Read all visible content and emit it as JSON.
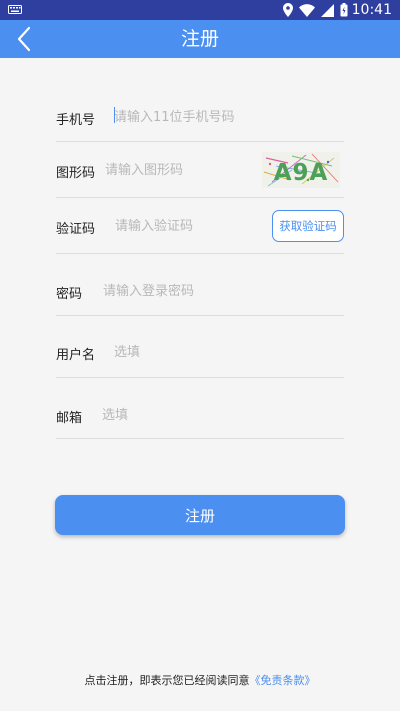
{
  "status_bar": {
    "time": "10:41",
    "icons": [
      "keyboard-icon",
      "location-icon",
      "wifi-icon",
      "signal-icon",
      "battery-icon"
    ]
  },
  "app_bar": {
    "title": "注册",
    "back_icon": "chevron-left-icon"
  },
  "form": {
    "phone": {
      "label": "手机号",
      "placeholder": "请输入11位手机号码",
      "value": ""
    },
    "captcha": {
      "label": "图形码",
      "placeholder": "请输入图形码",
      "value": "",
      "image_text": "A9A"
    },
    "sms_code": {
      "label": "验证码",
      "placeholder": "请输入验证码",
      "value": "",
      "button_label": "获取验证码"
    },
    "password": {
      "label": "密码",
      "placeholder": "请输入登录密码",
      "value": ""
    },
    "username": {
      "label": "用户名",
      "placeholder": "选填",
      "value": ""
    },
    "email": {
      "label": "邮箱",
      "placeholder": "选填",
      "value": ""
    }
  },
  "register_button": {
    "label": "注册"
  },
  "agreement": {
    "prefix": "点击注册，即表示您已经阅读同意",
    "link": "《免责条款》"
  },
  "colors": {
    "status_bar": "#2f3f9f",
    "primary": "#4b8ff0",
    "background": "#f5f5f5",
    "divider": "#dddddd",
    "placeholder": "#b8b8b8"
  }
}
